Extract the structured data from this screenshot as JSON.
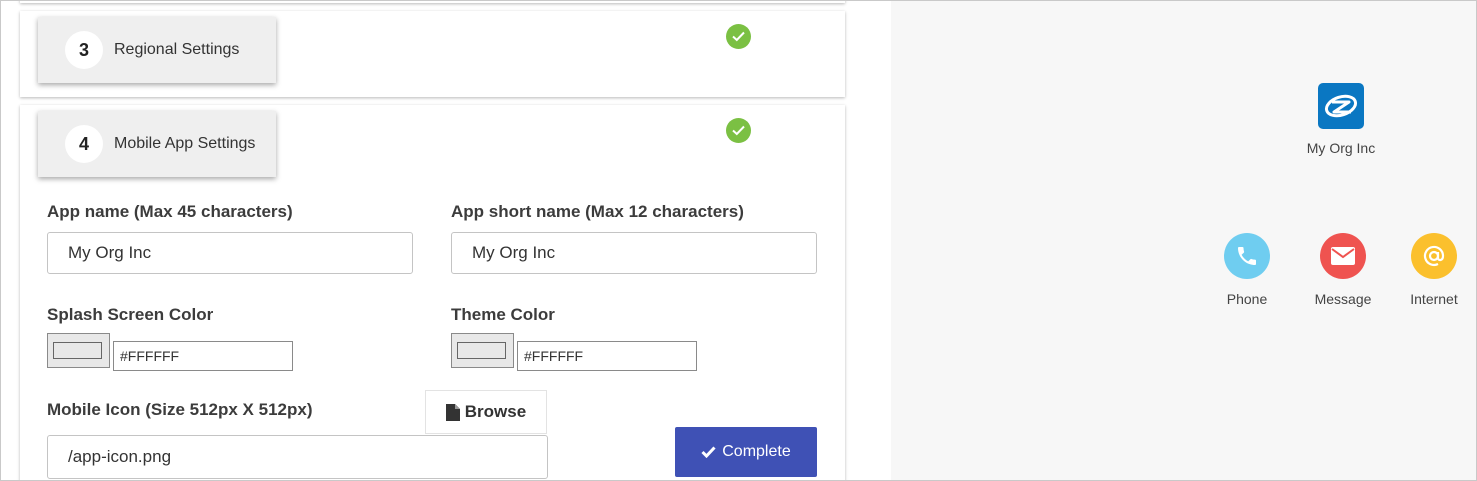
{
  "steps": [
    {
      "number": "3",
      "label": "Regional Settings",
      "complete": true
    },
    {
      "number": "4",
      "label": "Mobile App Settings",
      "complete": true
    }
  ],
  "form": {
    "app_name": {
      "label": "App name (Max 45 characters)",
      "value": "My Org Inc"
    },
    "app_short_name": {
      "label": "App short name (Max 12 characters)",
      "value": "My Org Inc"
    },
    "splash_color": {
      "label": "Splash Screen Color",
      "value": "#FFFFFF"
    },
    "theme_color": {
      "label": "Theme Color",
      "value": "#FFFFFF"
    },
    "mobile_icon": {
      "label": "Mobile Icon (Size 512px X 512px)",
      "value": "/app-icon.png"
    },
    "browse_label": "Browse",
    "complete_label": "Complete"
  },
  "preview": {
    "app_name": "My Org Inc",
    "actions": [
      {
        "label": "Phone",
        "color": "#6fcdf0",
        "icon": "phone-icon"
      },
      {
        "label": "Message",
        "color": "#ef5350",
        "icon": "mail-icon"
      },
      {
        "label": "Internet",
        "color": "#fbc02d",
        "icon": "at-icon"
      }
    ]
  },
  "colors": {
    "accent": "#3f51b5",
    "success": "#7bc043",
    "logo": "#0a77c2"
  }
}
